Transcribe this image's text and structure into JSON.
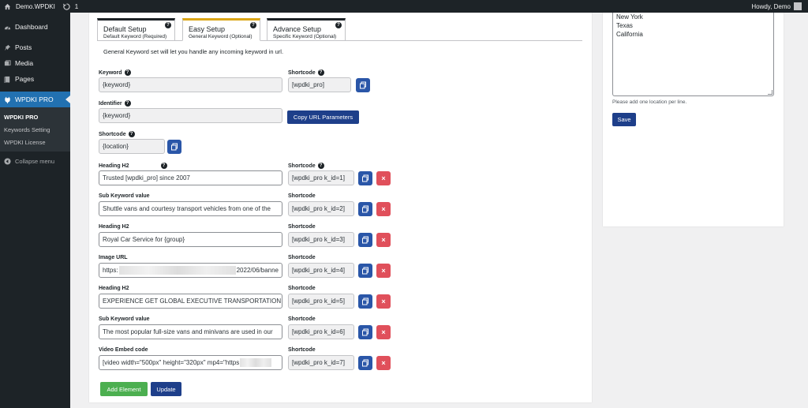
{
  "adminbar": {
    "site_name": "Demo.WPDKI",
    "updates_count": "1",
    "greeting": "Howdy, Demo"
  },
  "sidebar": {
    "items": [
      {
        "label": "Dashboard",
        "icon": "dashboard-icon"
      },
      {
        "label": "Posts",
        "icon": "pushpin-icon"
      },
      {
        "label": "Media",
        "icon": "media-icon"
      },
      {
        "label": "Pages",
        "icon": "pages-icon"
      },
      {
        "label": "WPDKI PRO",
        "icon": "plugin-icon"
      }
    ],
    "submenu": [
      "WPDKI PRO",
      "Keywords Setting",
      "WPDKI License"
    ],
    "collapse": "Collapse menu"
  },
  "tabs": [
    {
      "title": "Default Setup",
      "sub": "Default Keyword (Required)"
    },
    {
      "title": "Easy Setup",
      "sub": "General Keyword (Optional)"
    },
    {
      "title": "Advance Setup",
      "sub": "Specific Keyword (Optional)"
    }
  ],
  "description": "General Keyword set will let you handle any incoming keyword in url.",
  "keyword": {
    "label": "Keyword",
    "value": "{keyword}",
    "shortcode_label": "Shortcode",
    "shortcode": "[wpdki_pro]"
  },
  "identifier": {
    "label": "Identifier",
    "value": "{keyword}",
    "button": "Copy URL Parameters"
  },
  "location_shortcode": {
    "label": "Shortcode",
    "value": "{location}"
  },
  "rows": [
    {
      "label": "Heading H2",
      "value": "Trusted [wpdki_pro] since 2007",
      "shortcode_label": "Shortcode",
      "shortcode": "[wpdki_pro k_id=1]"
    },
    {
      "label": "Sub Keyword value",
      "value": "Shuttle vans and courtesy transport vehicles from one of the",
      "shortcode_label": "Shortcode",
      "shortcode": "[wpdki_pro k_id=2]"
    },
    {
      "label": "Heading H2",
      "value": "Royal Car Service for {group}",
      "shortcode_label": "Shortcode",
      "shortcode": "[wpdki_pro k_id=3]"
    },
    {
      "label": "Image URL",
      "value_prefix": "https:",
      "value_suffix": "2022/06/banne",
      "shortcode_label": "Shortcode",
      "shortcode": "[wpdki_pro k_id=4]"
    },
    {
      "label": "Heading H2",
      "value": "EXPERIENCE GET GLOBAL EXECUTIVE TRANSPORTATION",
      "shortcode_label": "Shortcode",
      "shortcode": "[wpdki_pro k_id=5]"
    },
    {
      "label": "Sub Keyword value",
      "value": "The most popular full-size vans and minivans are used in our",
      "shortcode_label": "Shortcode",
      "shortcode": "[wpdki_pro k_id=6]"
    },
    {
      "label": "Video Embed code",
      "value_prefix": "[video width=\"500px\" height=\"320px\" mp4=\"https",
      "shortcode_label": "Shortcode",
      "shortcode": "[wpdki_pro k_id=7]"
    }
  ],
  "actions": {
    "add": "Add Element",
    "update": "Update"
  },
  "locations": {
    "lines": [
      "New York",
      "Texas",
      "California"
    ],
    "hint": "Please add one location per line.",
    "save": "Save"
  }
}
